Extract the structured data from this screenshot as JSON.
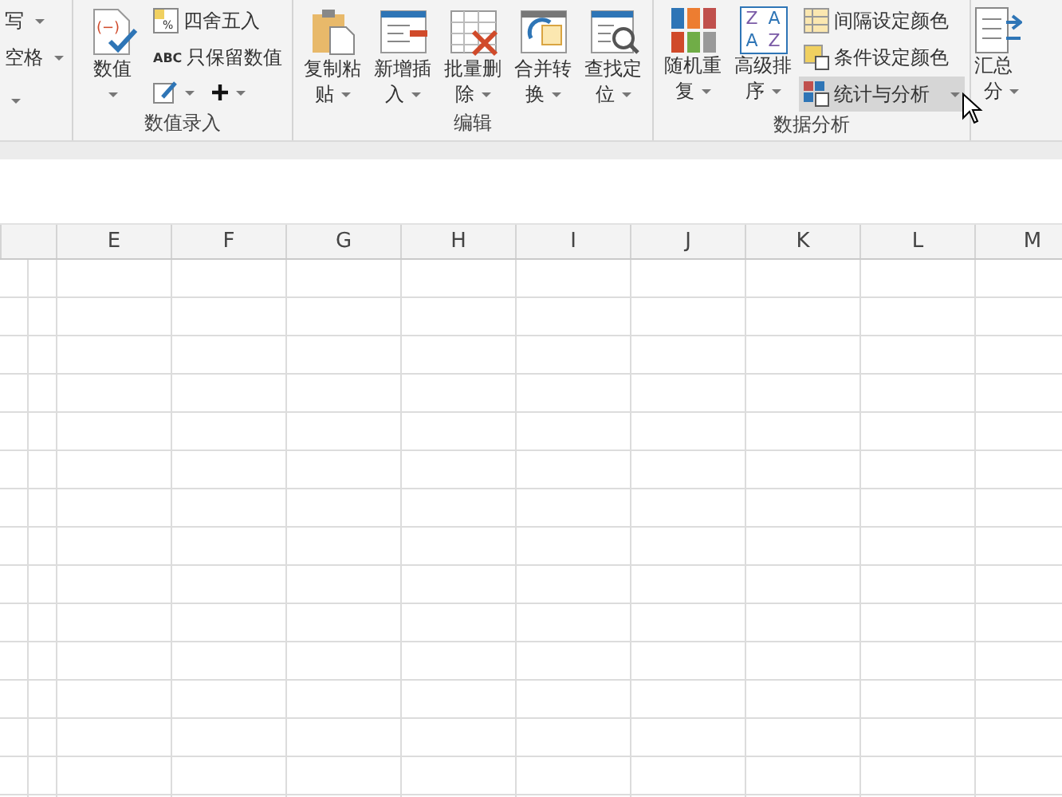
{
  "ribbon": {
    "partial_left": {
      "items": [
        {
          "label": "写"
        },
        {
          "label": "空格"
        }
      ]
    },
    "groups": [
      {
        "title": "数值录入",
        "big_buttons": [
          {
            "label_lines": [
              "数值"
            ],
            "icon_text": "(−)"
          }
        ],
        "small_items": [
          {
            "label": "四舍五入",
            "icon_text": "%",
            "selected": false,
            "dropdown": false
          },
          {
            "label": "只保留数值",
            "icon_text": "ABC",
            "selected": false,
            "dropdown": false
          }
        ],
        "icon_dropdowns": [
          {
            "kind": "edit"
          },
          {
            "kind": "plus"
          }
        ]
      },
      {
        "title": "编辑",
        "big_buttons": [
          {
            "label_lines": [
              "复制粘",
              "贴"
            ]
          },
          {
            "label_lines": [
              "新增插",
              "入"
            ]
          },
          {
            "label_lines": [
              "批量删",
              "除"
            ]
          },
          {
            "label_lines": [
              "合并转",
              "换"
            ]
          },
          {
            "label_lines": [
              "查找定",
              "位"
            ]
          }
        ]
      },
      {
        "title": "数据分析",
        "big_buttons": [
          {
            "label_lines": [
              "随机重",
              "复"
            ]
          },
          {
            "label_lines": [
              "高级排",
              "序"
            ],
            "icon_letters": [
              "Z",
              "A",
              "A",
              "Z"
            ]
          }
        ],
        "small_items": [
          {
            "label": "间隔设定颜色",
            "selected": false,
            "dropdown": false
          },
          {
            "label": "条件设定颜色",
            "selected": false,
            "dropdown": false
          },
          {
            "label": "统计与分析",
            "selected": true,
            "dropdown": true
          }
        ]
      }
    ],
    "partial_right": {
      "label_top": "汇总",
      "label_bottom": "分"
    }
  },
  "sheet": {
    "columns": [
      "E",
      "F",
      "G",
      "H",
      "I",
      "J",
      "K",
      "L",
      "M"
    ]
  }
}
